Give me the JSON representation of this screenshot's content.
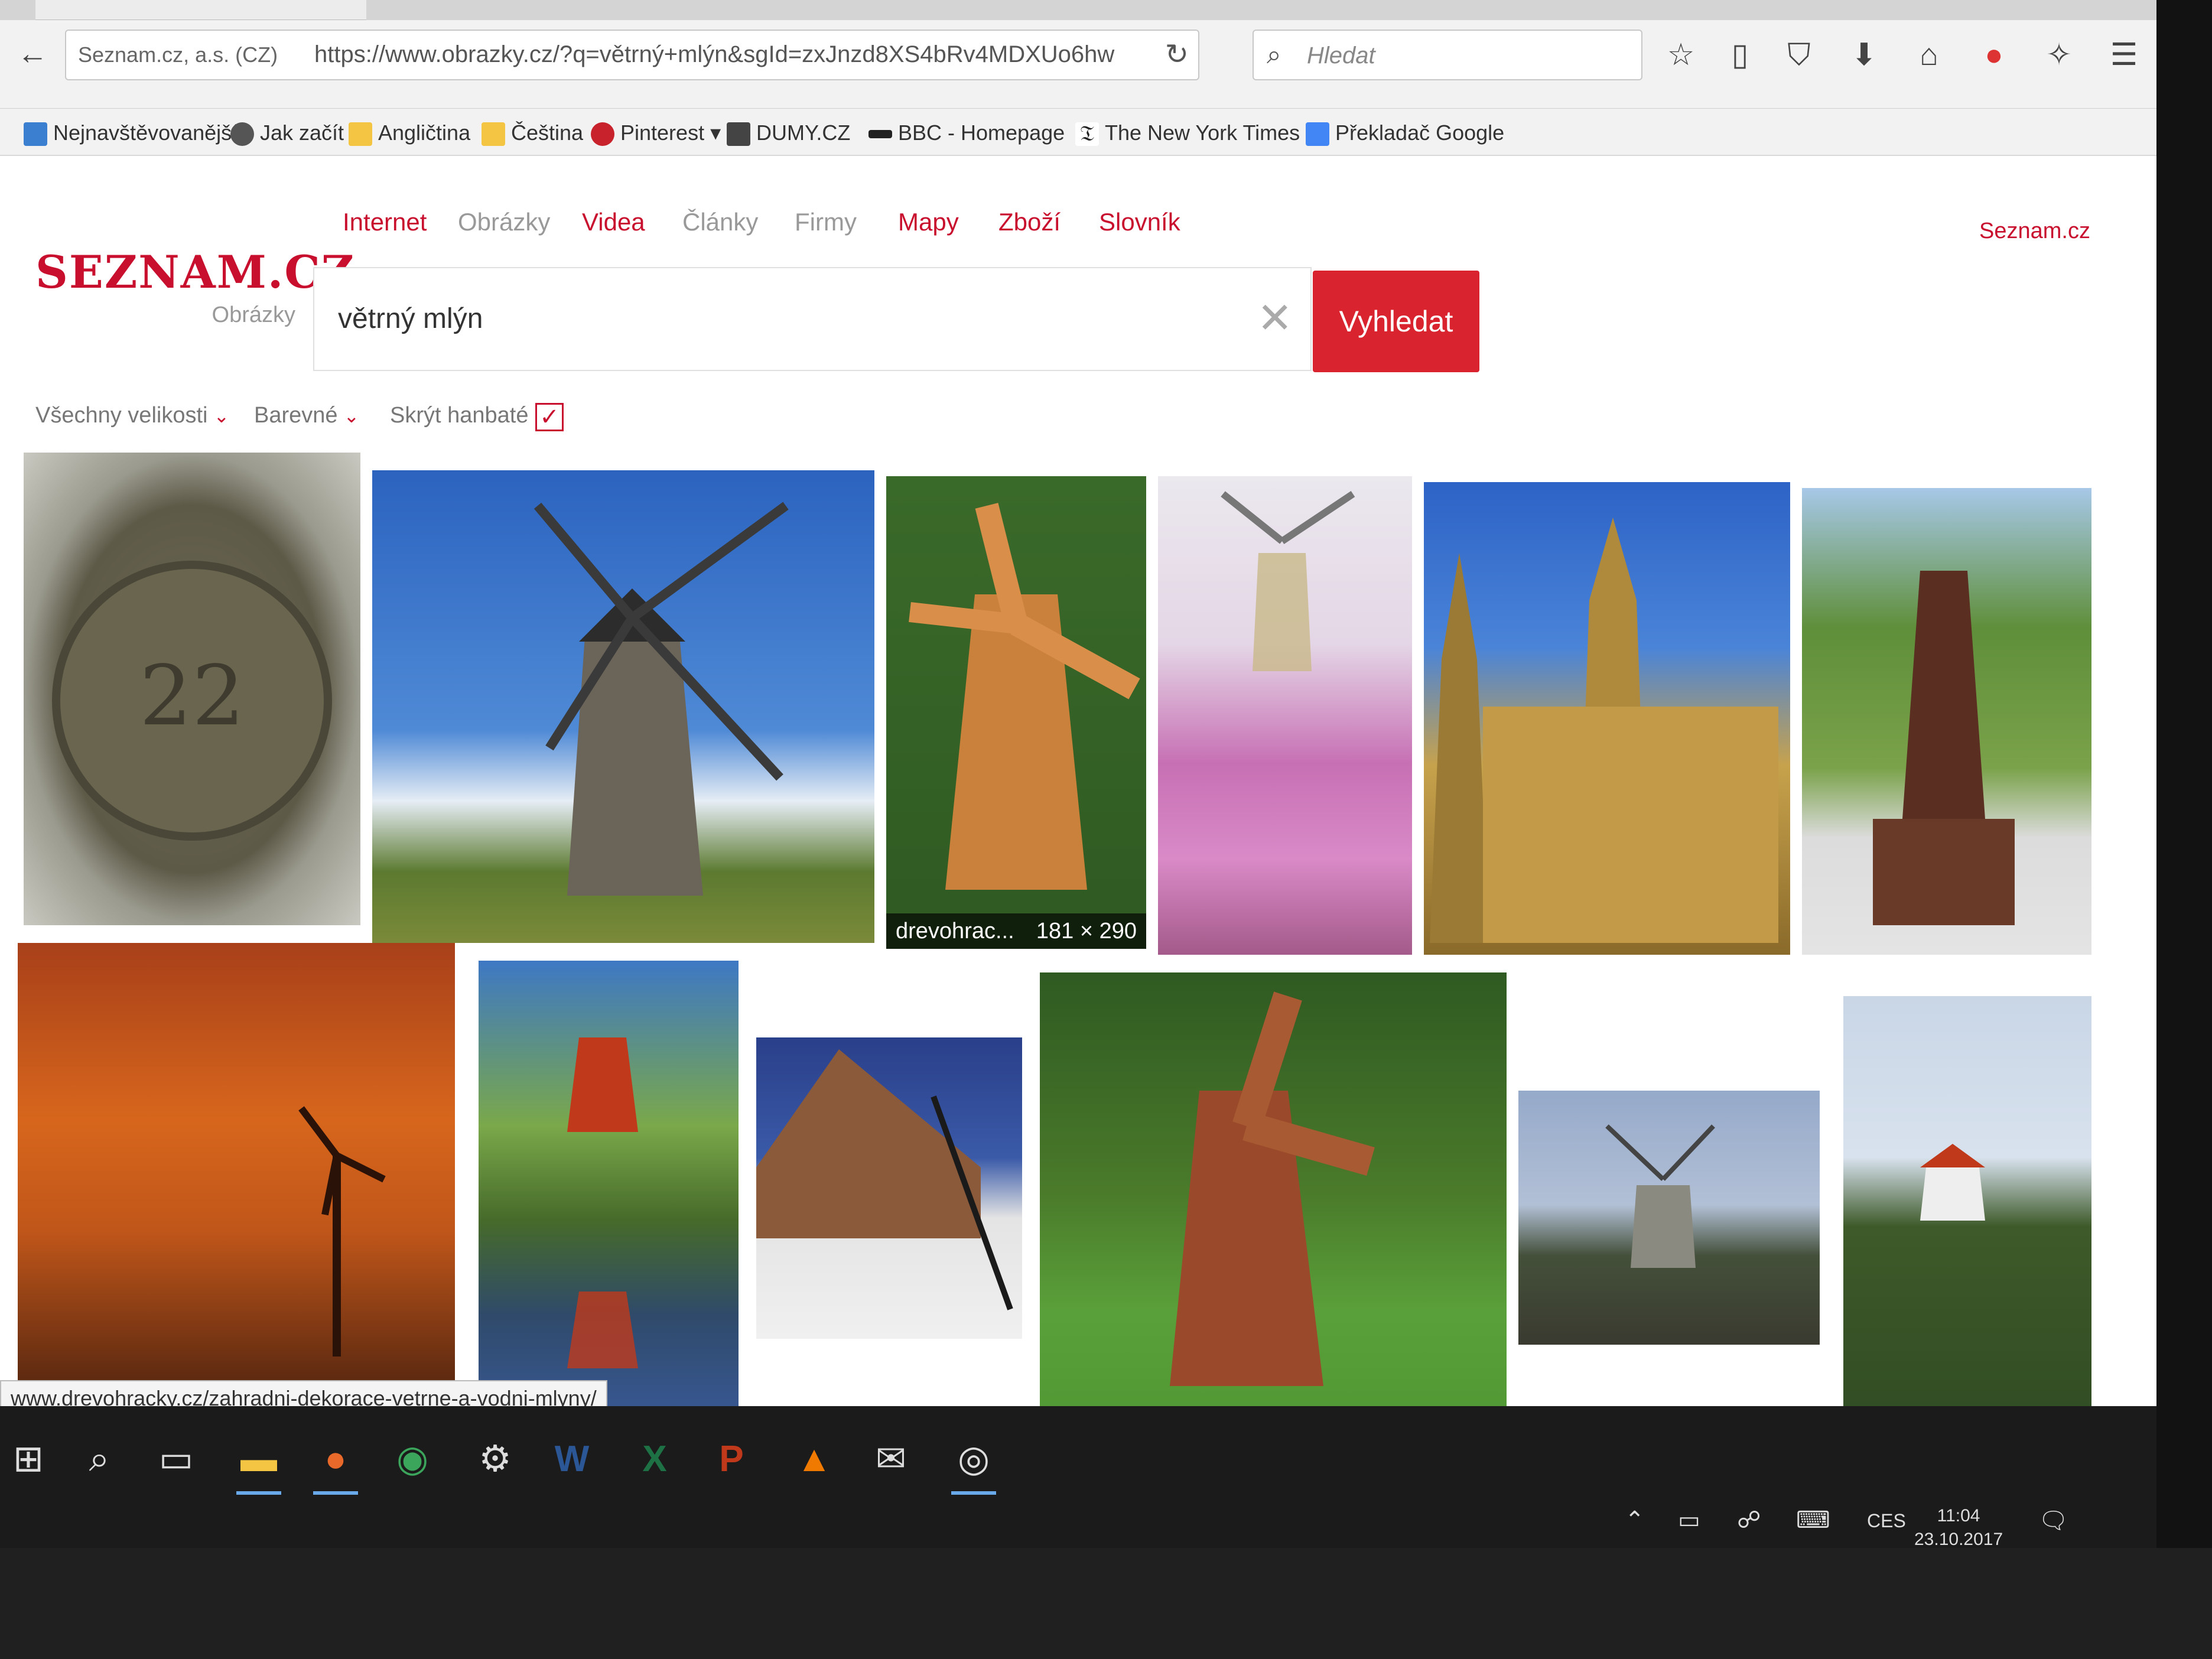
{
  "browser": {
    "site_info": "Seznam.cz, a.s. (CZ)",
    "url": "https://www.obrazky.cz/?q=větrný+mlýn&sgId=zxJnzd8XS4bRv4MDXUo6hw",
    "search_placeholder": "Hledat",
    "bookmarks": [
      {
        "label": "Nejnavštěvovanější",
        "icon": "firefox-icon",
        "color": "#3b7fd1"
      },
      {
        "label": "Jak začít",
        "icon": "globe-icon",
        "color": "#555555"
      },
      {
        "label": "Angličtina",
        "icon": "folder-icon",
        "color": "#f4c542"
      },
      {
        "label": "Čeština",
        "icon": "folder-icon",
        "color": "#f4c542"
      },
      {
        "label": "Pinterest",
        "icon": "pinterest-icon",
        "color": "#c8232c"
      },
      {
        "label": "DUMY.CZ",
        "icon": "building-icon",
        "color": "#444444"
      },
      {
        "label": "BBC - Homepage",
        "icon": "bbc-icon",
        "color": "#222222"
      },
      {
        "label": "The New York Times",
        "icon": "nyt-icon",
        "color": "#222222"
      },
      {
        "label": "Překladač Google",
        "icon": "translate-icon",
        "color": "#4285f4"
      }
    ]
  },
  "seznam": {
    "logo": "SEZNAM.CZ",
    "logo_sub": "Obrázky",
    "tabs": [
      "Internet",
      "Obrázky",
      "Videa",
      "Články",
      "Firmy",
      "Mapy",
      "Zboží",
      "Slovník"
    ],
    "account": "Seznam.cz",
    "query": "větrný mlýn",
    "search_button": "Vyhledat",
    "filters": {
      "size": "Všechny velikosti",
      "color": "Barevné",
      "hide": "Skrýt hanbaté",
      "hide_checked": "✓"
    }
  },
  "results": [
    {
      "name": "coin-22",
      "colors": [
        "#8a8a78",
        "#5e5a48"
      ]
    },
    {
      "name": "stone-windmill-blue-sky",
      "colors": [
        "#2f6fc2",
        "#cfd8e6"
      ]
    },
    {
      "name": "wooden-garden-windmill",
      "colors": [
        "#c9813c",
        "#2f5a22"
      ],
      "label": "drevohrac...",
      "size": "181 × 290"
    },
    {
      "name": "windmill-flowers",
      "colors": [
        "#e7e3ea",
        "#c770b4"
      ]
    },
    {
      "name": "st-vitus-cathedral",
      "colors": [
        "#2d63c6",
        "#c7a24c"
      ]
    },
    {
      "name": "brown-wooden-windmill-park",
      "colors": [
        "#d8d8d8",
        "#6a3a28"
      ]
    },
    {
      "name": "sunset-wind-turbine",
      "colors": [
        "#c55a18",
        "#3c1a10"
      ]
    },
    {
      "name": "red-windmill-reflection",
      "colors": [
        "#3e78c4",
        "#b83a20"
      ]
    },
    {
      "name": "thatched-windmill-roof",
      "colors": [
        "#2a3f8a",
        "#8a5a3a"
      ]
    },
    {
      "name": "wooden-windmill-lawn",
      "colors": [
        "#3c7a2a",
        "#9a4a2a"
      ]
    },
    {
      "name": "stone-windmill-dusk",
      "colors": [
        "#95a9c9",
        "#3a3a30"
      ]
    },
    {
      "name": "white-windmill-hill",
      "colors": [
        "#c9d6e6",
        "#2f4a22"
      ]
    }
  ],
  "status_url": "www.drevohracky.cz/zahradni-dekorace-vetrne-a-vodni-mlyny/",
  "taskbar": {
    "apps": [
      "windows-start-icon",
      "search-icon",
      "task-view-icon",
      "file-explorer-icon",
      "firefox-icon",
      "chrome-icon",
      "app-icon",
      "word-icon",
      "excel-icon",
      "powerpoint-icon",
      "vlc-icon",
      "mail-icon",
      "spiral-app-icon"
    ],
    "language": "CES",
    "time": "11:04",
    "date": "23.10.2017"
  }
}
